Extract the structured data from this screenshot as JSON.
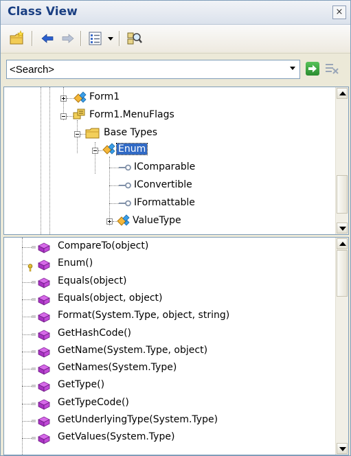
{
  "window": {
    "title": "Class View",
    "close_label": "×"
  },
  "toolbar": {
    "items": [
      "new-folder-icon",
      "back-arrow-icon",
      "forward-arrow-icon",
      "sort-icon",
      "dropdown-arrow-icon",
      "browse-icon"
    ]
  },
  "search": {
    "placeholder": "<Search>",
    "value": ""
  },
  "tree": {
    "items": [
      {
        "label": "Form1",
        "level": 1,
        "expander": "plus"
      },
      {
        "label": "Form1.MenuFlags",
        "level": 1,
        "expander": "minus"
      },
      {
        "label": "Base Types",
        "level": 2,
        "expander": "minus"
      },
      {
        "label": "Enum",
        "level": 3,
        "expander": "minus",
        "selected": true
      },
      {
        "label": "IComparable",
        "level": 4,
        "expander": "none"
      },
      {
        "label": "IConvertible",
        "level": 4,
        "expander": "none"
      },
      {
        "label": "IFormattable",
        "level": 4,
        "expander": "none"
      },
      {
        "label": "ValueType",
        "level": 4,
        "expander": "plus"
      }
    ]
  },
  "members": {
    "items": [
      "CompareTo(object)",
      "Enum()",
      "Equals(object)",
      "Equals(object, object)",
      "Format(System.Type, object, string)",
      "GetHashCode()",
      "GetName(System.Type, object)",
      "GetNames(System.Type)",
      "GetType()",
      "GetTypeCode()",
      "GetUnderlyingType(System.Type)",
      "GetValues(System.Type)"
    ]
  },
  "colors": {
    "selection": "#316ac5",
    "title_text": "#1a3f82",
    "method_icon": "#b23ad0",
    "border": "#7f9db9"
  }
}
